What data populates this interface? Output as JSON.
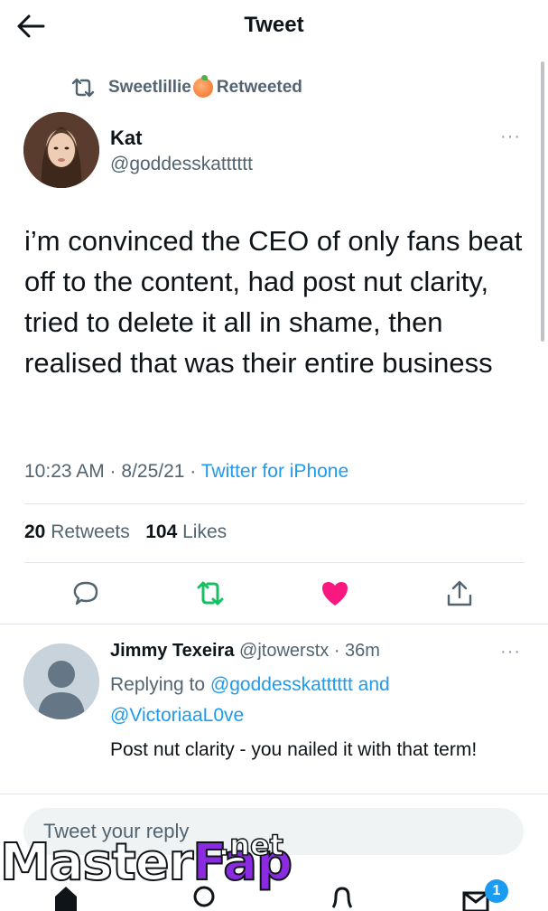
{
  "header": {
    "title": "Tweet"
  },
  "retweet": {
    "user": "Sweetlillie",
    "suffix": "Retweeted"
  },
  "tweet": {
    "author_name": "Kat",
    "author_handle": "@goddesskatttttt",
    "text": "i’m convinced the CEO of only fans beat off to the content, had post nut clarity, tried to delete it all in shame, then realised that was their entire business",
    "time": "10:23 AM · 8/25/21 · ",
    "source": "Twitter for iPhone",
    "more": "···"
  },
  "stats": {
    "retweets_count": "20",
    "retweets_label": " Retweets",
    "likes_count": "104",
    "likes_label": " Likes"
  },
  "actions": {
    "like_color": "#f91880",
    "retweet_color": "#17bf63"
  },
  "reply": {
    "name": "Jimmy Texeira",
    "meta": " @jtowerstx · 36m",
    "replying_prefix": "Replying to ",
    "replying_user1": "@goddesskatttttt",
    "replying_and": " and",
    "replying_user2": "@VictoriaaL0ve",
    "text": "Post nut clarity - you nailed it with that term!",
    "more": "···"
  },
  "compose": {
    "placeholder": "Tweet your reply"
  },
  "watermark": {
    "text_a": "Master",
    "text_b": "Fap",
    "text_c": ".net"
  },
  "nav": {
    "messages_badge": "1"
  },
  "icons": {
    "back": "arrow-left-icon",
    "retweet": "retweet-icon",
    "reply": "reply-icon",
    "like": "heart-icon",
    "share": "share-icon",
    "home": "home-icon",
    "search": "search-icon",
    "notifications": "bell-icon",
    "messages": "mail-icon"
  }
}
